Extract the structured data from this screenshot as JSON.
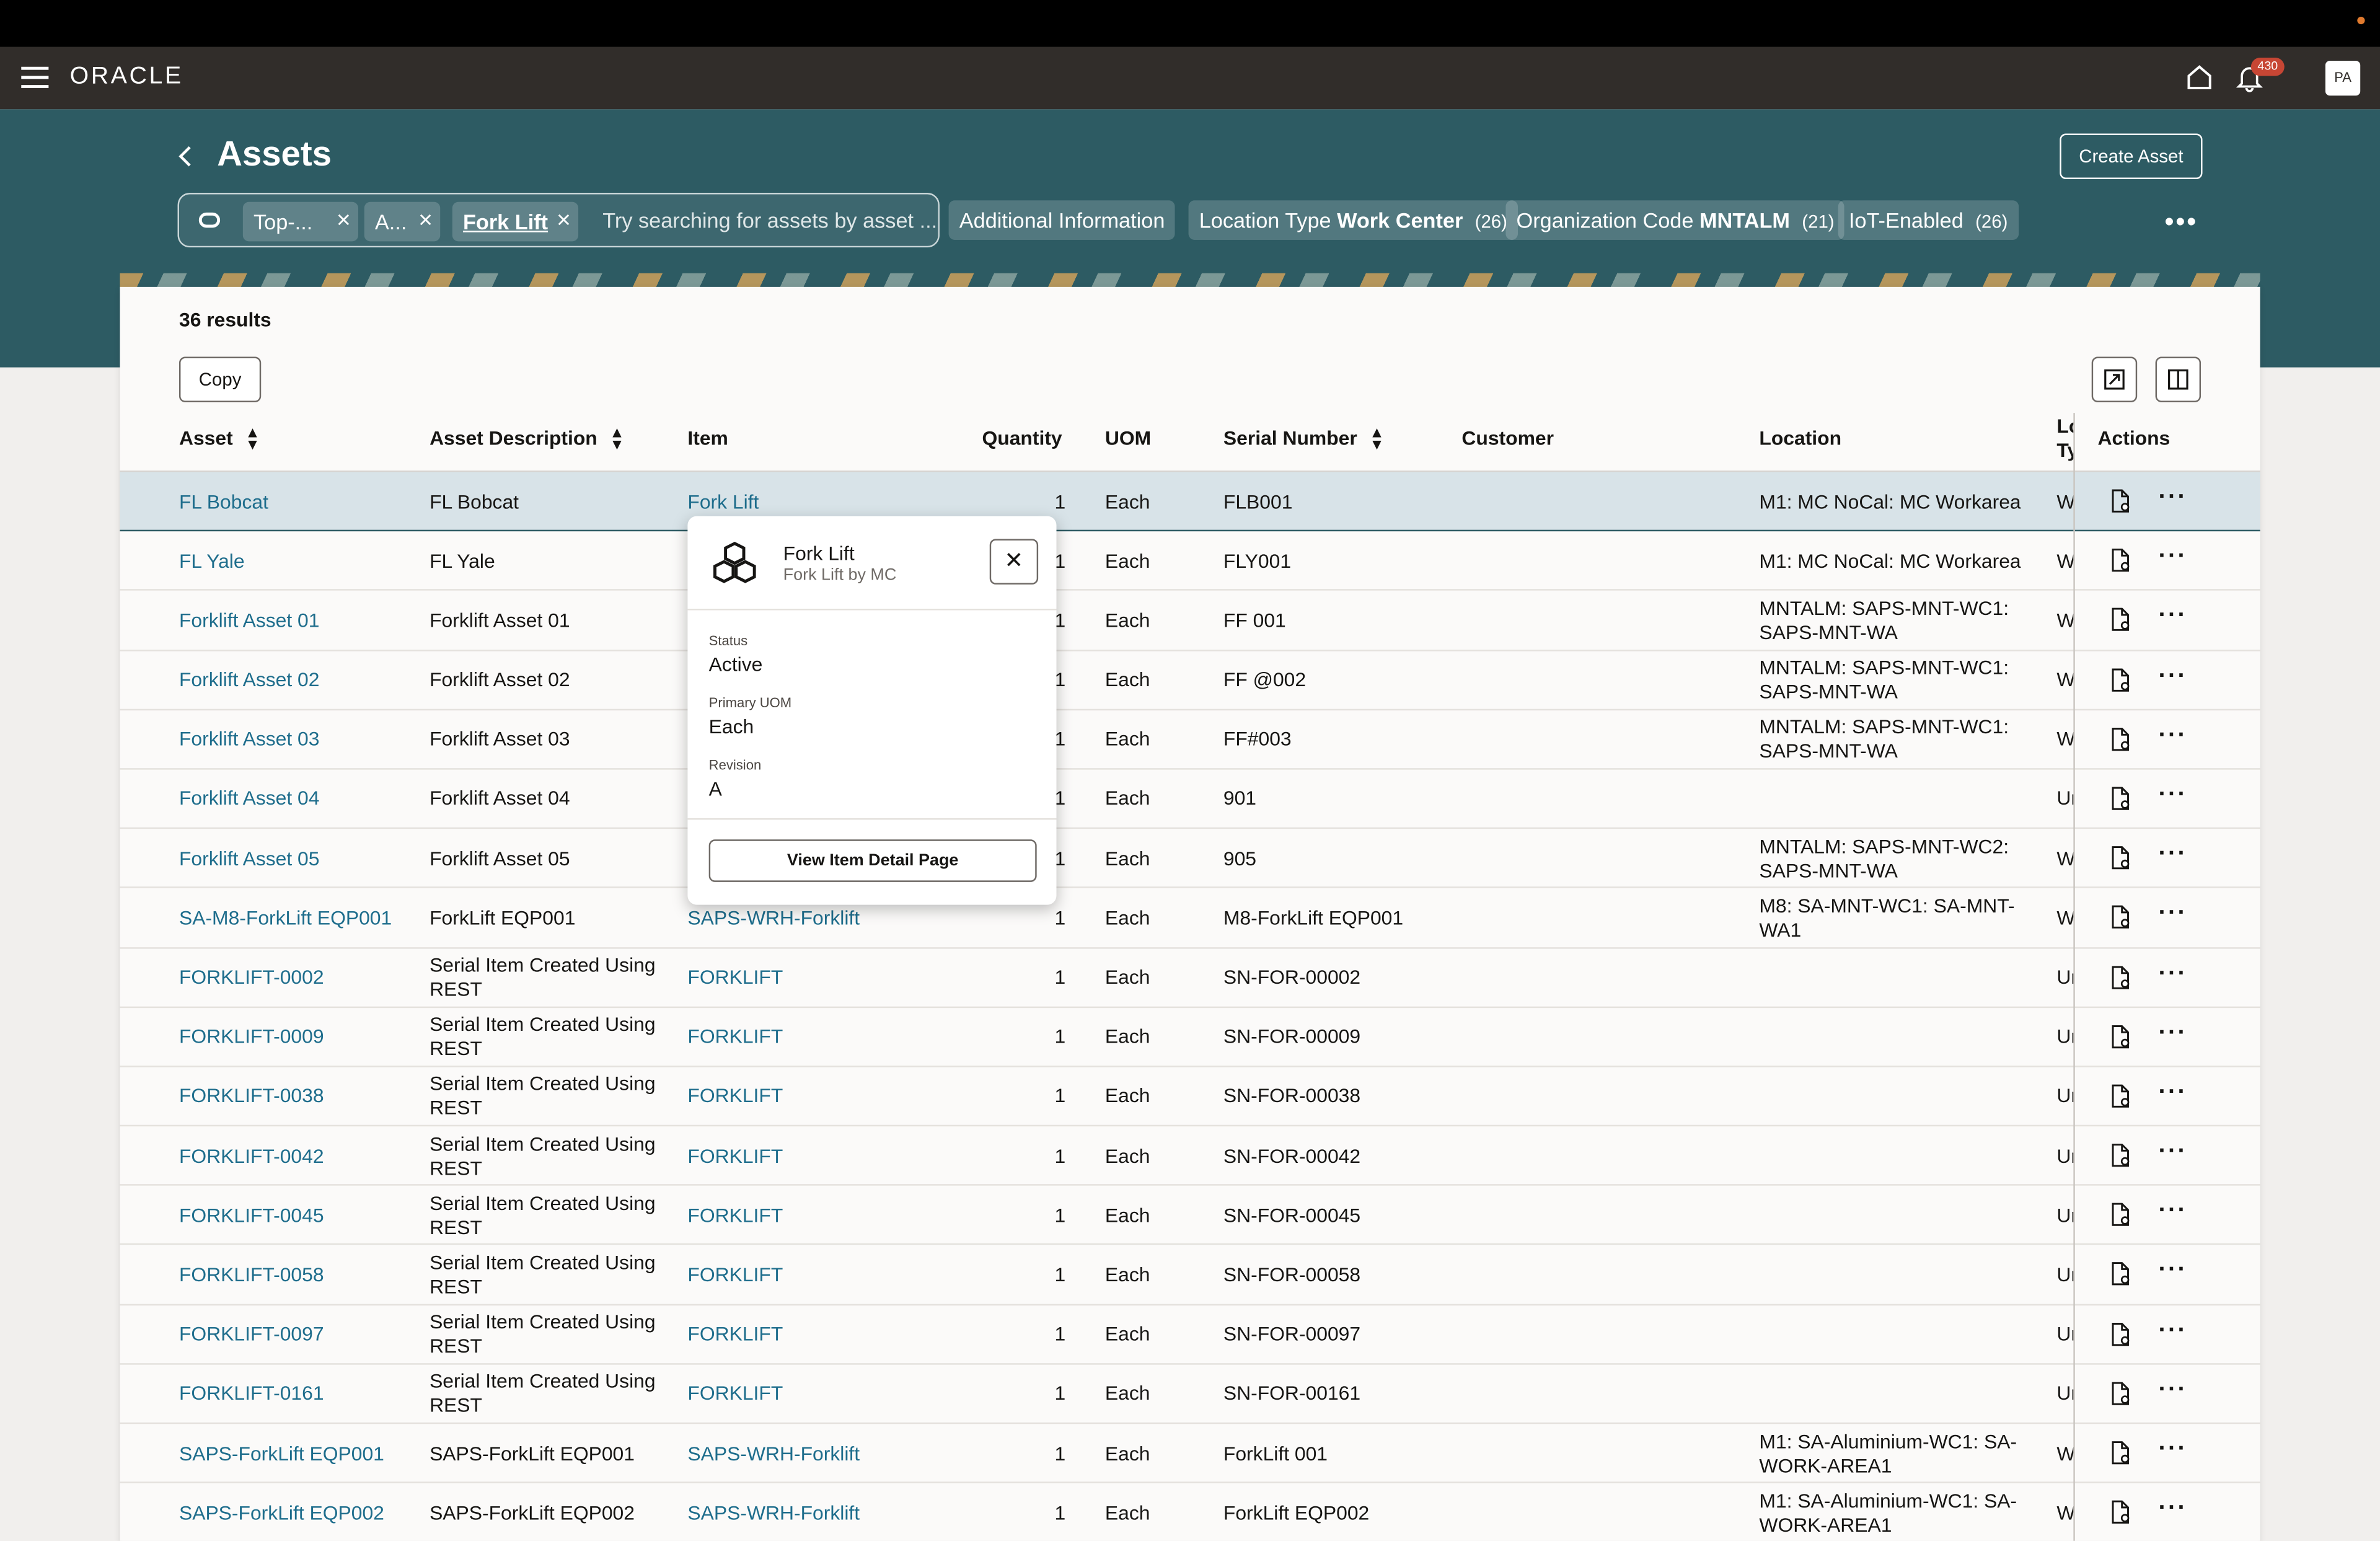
{
  "brand": {
    "logo": "ORACLE",
    "notification_count": "430",
    "avatar_initials": "PA"
  },
  "page": {
    "title": "Assets",
    "create_label": "Create Asset"
  },
  "search": {
    "chips": [
      "Top-...",
      "A...",
      "Fork Lift"
    ],
    "placeholder": "Try searching for assets by asset ..."
  },
  "filters": [
    {
      "label": "Additional Information",
      "value": "",
      "count": ""
    },
    {
      "label": "Location Type",
      "value": "Work Center",
      "count": "(26)"
    },
    {
      "label": "Organization Code",
      "value": "MNTALM",
      "count": "(21)"
    },
    {
      "label": "IoT-Enabled",
      "value": "",
      "count": "(26)"
    }
  ],
  "results": {
    "count_label": "36 results",
    "copy_label": "Copy"
  },
  "columns": {
    "asset": "Asset",
    "description": "Asset Description",
    "item": "Item",
    "quantity": "Quantity",
    "uom": "UOM",
    "serial": "Serial Number",
    "customer": "Customer",
    "location": "Location",
    "loc_type_1": "Lo",
    "loc_type_2": "Ty",
    "actions": "Actions"
  },
  "rows": [
    {
      "asset": "FL Bobcat",
      "desc": "FL Bobcat",
      "item": "Fork Lift",
      "qty": "1",
      "uom": "Each",
      "serial": "FLB001",
      "location": "M1: MC NoCal: MC Workarea",
      "loctype": "W"
    },
    {
      "asset": "FL Yale",
      "desc": "FL Yale",
      "item": "",
      "qty": "1",
      "uom": "Each",
      "serial": "FLY001",
      "location": "M1: MC NoCal: MC Workarea",
      "loctype": "W"
    },
    {
      "asset": "Forklift Asset 01",
      "desc": "Forklift Asset 01",
      "item": "",
      "qty": "1",
      "uom": "Each",
      "serial": "FF 001",
      "location": "MNTALM: SAPS-MNT-WC1: SAPS-MNT-WA",
      "loctype": "W"
    },
    {
      "asset": "Forklift Asset 02",
      "desc": "Forklift Asset 02",
      "item": "",
      "qty": "1",
      "uom": "Each",
      "serial": "FF @002",
      "location": "MNTALM: SAPS-MNT-WC1: SAPS-MNT-WA",
      "loctype": "W"
    },
    {
      "asset": "Forklift Asset 03",
      "desc": "Forklift Asset 03",
      "item": "",
      "qty": "1",
      "uom": "Each",
      "serial": "FF#003",
      "location": "MNTALM: SAPS-MNT-WC1: SAPS-MNT-WA",
      "loctype": "W"
    },
    {
      "asset": "Forklift Asset 04",
      "desc": "Forklift Asset 04",
      "item": "",
      "qty": "1",
      "uom": "Each",
      "serial": "901",
      "location": "",
      "loctype": "Ur"
    },
    {
      "asset": "Forklift Asset 05",
      "desc": "Forklift Asset 05",
      "item": "",
      "qty": "1",
      "uom": "Each",
      "serial": "905",
      "location": "MNTALM: SAPS-MNT-WC2: SAPS-MNT-WA",
      "loctype": "W"
    },
    {
      "asset": "SA-M8-ForkLift EQP001",
      "desc": "ForkLift EQP001",
      "item": "SAPS-WRH-Forklift",
      "qty": "1",
      "uom": "Each",
      "serial": "M8-ForkLift EQP001",
      "location": "M8: SA-MNT-WC1: SA-MNT-WA1",
      "loctype": "W"
    },
    {
      "asset": "FORKLIFT-0002",
      "desc": "Serial Item Created Using REST",
      "item": "FORKLIFT",
      "qty": "1",
      "uom": "Each",
      "serial": "SN-FOR-00002",
      "location": "",
      "loctype": "Ur"
    },
    {
      "asset": "FORKLIFT-0009",
      "desc": "Serial Item Created Using REST",
      "item": "FORKLIFT",
      "qty": "1",
      "uom": "Each",
      "serial": "SN-FOR-00009",
      "location": "",
      "loctype": "Ur"
    },
    {
      "asset": "FORKLIFT-0038",
      "desc": "Serial Item Created Using REST",
      "item": "FORKLIFT",
      "qty": "1",
      "uom": "Each",
      "serial": "SN-FOR-00038",
      "location": "",
      "loctype": "Ur"
    },
    {
      "asset": "FORKLIFT-0042",
      "desc": "Serial Item Created Using REST",
      "item": "FORKLIFT",
      "qty": "1",
      "uom": "Each",
      "serial": "SN-FOR-00042",
      "location": "",
      "loctype": "Ur"
    },
    {
      "asset": "FORKLIFT-0045",
      "desc": "Serial Item Created Using REST",
      "item": "FORKLIFT",
      "qty": "1",
      "uom": "Each",
      "serial": "SN-FOR-00045",
      "location": "",
      "loctype": "Ur"
    },
    {
      "asset": "FORKLIFT-0058",
      "desc": "Serial Item Created Using REST",
      "item": "FORKLIFT",
      "qty": "1",
      "uom": "Each",
      "serial": "SN-FOR-00058",
      "location": "",
      "loctype": "Ur"
    },
    {
      "asset": "FORKLIFT-0097",
      "desc": "Serial Item Created Using REST",
      "item": "FORKLIFT",
      "qty": "1",
      "uom": "Each",
      "serial": "SN-FOR-00097",
      "location": "",
      "loctype": "Ur"
    },
    {
      "asset": "FORKLIFT-0161",
      "desc": "Serial Item Created Using REST",
      "item": "FORKLIFT",
      "qty": "1",
      "uom": "Each",
      "serial": "SN-FOR-00161",
      "location": "",
      "loctype": "Ur"
    },
    {
      "asset": "SAPS-ForkLift EQP001",
      "desc": "SAPS-ForkLift EQP001",
      "item": "SAPS-WRH-Forklift",
      "qty": "1",
      "uom": "Each",
      "serial": "ForkLift 001",
      "location": "M1: SA-Aluminium-WC1: SA-WORK-AREA1",
      "loctype": "W"
    },
    {
      "asset": "SAPS-ForkLift EQP002",
      "desc": "SAPS-ForkLift EQP002",
      "item": "SAPS-WRH-Forklift",
      "qty": "1",
      "uom": "Each",
      "serial": "ForkLift EQP002",
      "location": "M1: SA-Aluminium-WC1: SA-WORK-AREA1",
      "loctype": "W"
    }
  ],
  "popup": {
    "title": "Fork Lift",
    "subtitle": "Fork Lift by MC",
    "status_label": "Status",
    "status_value": "Active",
    "uom_label": "Primary UOM",
    "uom_value": "Each",
    "revision_label": "Revision",
    "revision_value": "A",
    "button_label": "View Item Detail Page"
  },
  "colors": {
    "brand_bar": "#312d2a",
    "hero": "#2d5b63",
    "link": "#1e6d8c",
    "badge": "#c74634",
    "selected_row": "#d8e3e8"
  },
  "icons": [
    "hamburger-icon",
    "home-icon",
    "bell-icon",
    "back-chevron-icon",
    "search-ring-icon",
    "close-icon",
    "export-icon",
    "columns-icon",
    "sort-icon",
    "document-icon",
    "more-icon",
    "item-cubes-icon"
  ]
}
